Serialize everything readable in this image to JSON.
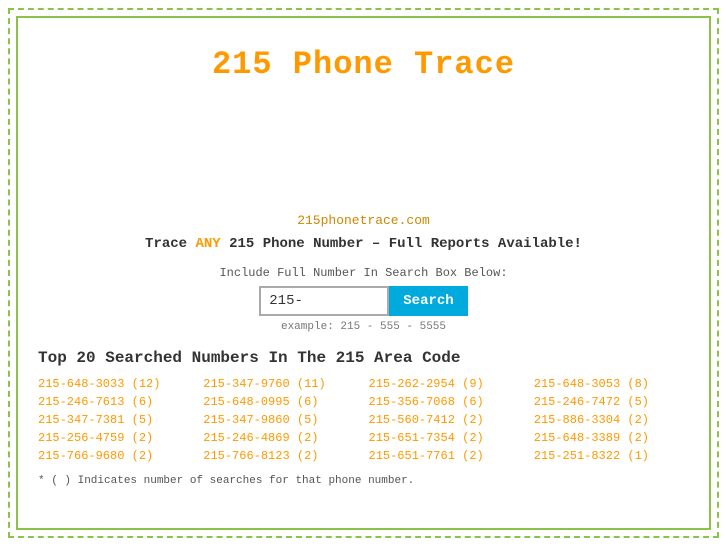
{
  "page": {
    "title": "215 Phone Trace",
    "site_link": "215phonetrace.com",
    "tagline_prefix": "Trace ",
    "tagline_any": "ANY",
    "tagline_suffix": " 215 Phone Number – Full Reports Available!",
    "search_label": "Include Full Number In Search Box Below:",
    "search_value": "215-",
    "search_button": "Search",
    "search_example": "example: 215 - 555 - 5555",
    "top_numbers_heading": "Top 20 Searched Numbers In The 215 Area Code",
    "numbers": [
      {
        "text": "215-648-3033 (12)",
        "col": 0
      },
      {
        "text": "215-347-9760 (11)",
        "col": 1
      },
      {
        "text": "215-262-2954 (9)",
        "col": 2
      },
      {
        "text": "215-648-3053 (8)",
        "col": 3
      },
      {
        "text": "215-246-7613 (6)",
        "col": 0
      },
      {
        "text": "215-648-0995 (6)",
        "col": 1
      },
      {
        "text": "215-356-7068 (6)",
        "col": 2
      },
      {
        "text": "215-246-7472 (5)",
        "col": 3
      },
      {
        "text": "215-347-7381 (5)",
        "col": 0
      },
      {
        "text": "215-347-9860 (5)",
        "col": 1
      },
      {
        "text": "215-560-7412 (2)",
        "col": 2
      },
      {
        "text": "215-886-3304 (2)",
        "col": 3
      },
      {
        "text": "215-256-4759 (2)",
        "col": 0
      },
      {
        "text": "215-246-4869 (2)",
        "col": 1
      },
      {
        "text": "215-651-7354 (2)",
        "col": 2
      },
      {
        "text": "215-648-3389 (2)",
        "col": 3
      },
      {
        "text": "215-766-9680 (2)",
        "col": 0
      },
      {
        "text": "215-766-8123 (2)",
        "col": 1
      },
      {
        "text": "215-651-7761 (2)",
        "col": 2
      },
      {
        "text": "215-251-8322 (1)",
        "col": 3
      }
    ],
    "footnote": "* ( ) Indicates number of searches for that phone number."
  }
}
